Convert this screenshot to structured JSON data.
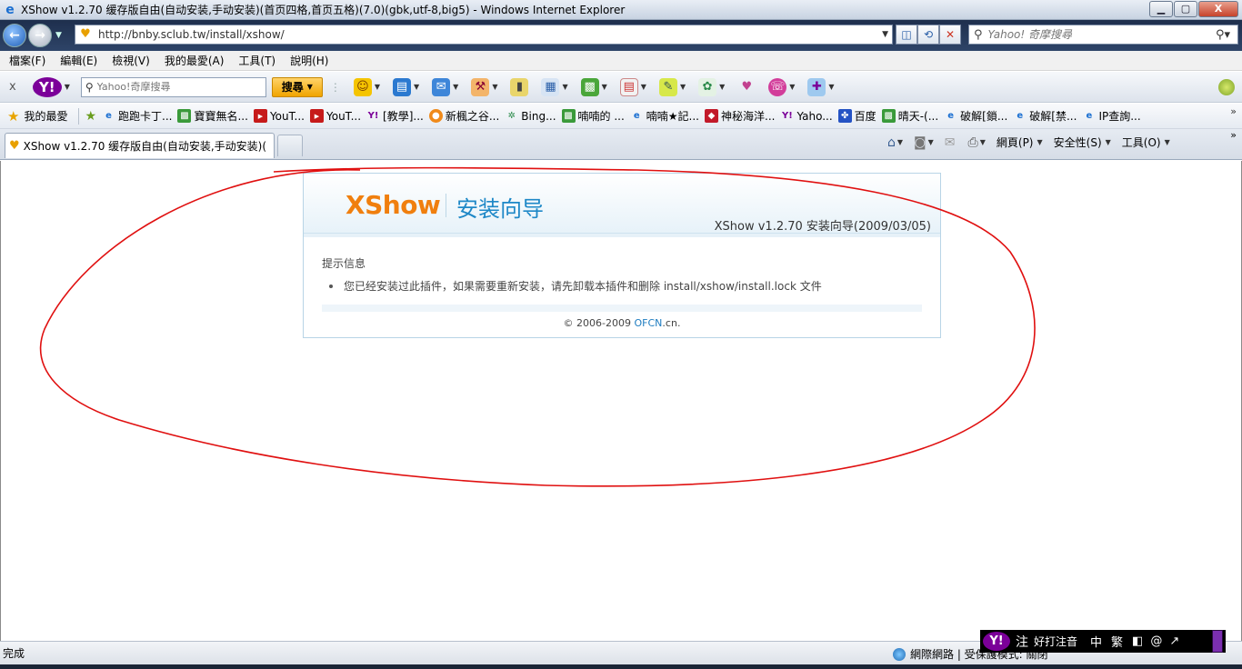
{
  "window": {
    "title": "XShow v1.2.70 缓存版自由(自动安装,手动安装)(首页四格,首页五格)(7.0)(gbk,utf-8,big5) - Windows Internet Explorer",
    "minimize": "▁",
    "maximize": "▢",
    "close": "X"
  },
  "address": {
    "url": "http://bnby.sclub.tw/install/xshow/",
    "search_placeholder": "Yahoo! 奇摩搜尋"
  },
  "menu": {
    "items": [
      "檔案(F)",
      "編輯(E)",
      "檢視(V)",
      "我的最愛(A)",
      "工具(T)",
      "說明(H)"
    ]
  },
  "yahoo_toolbar": {
    "close": "x",
    "logo": "Y!",
    "search_placeholder": "Yahoo!奇摩搜尋",
    "search_button": "搜尋"
  },
  "favorites": {
    "label": "我的最愛",
    "items": [
      "跑跑卡丁...",
      "寶寶無名...",
      "YouT...",
      "YouT...",
      "[教學]...",
      "新楓之谷...",
      "Bing...",
      "喃喃的 ...",
      "喃喃★記...",
      "神秘海洋...",
      "Yaho...",
      "百度",
      "晴天-(...",
      "破解[鎖...",
      "破解[禁...",
      "IP查詢..."
    ]
  },
  "tabs": {
    "active_label": "XShow v1.2.70 缓存版自由(自动安装,手动安装)(...",
    "cmd_page": "網頁(P)",
    "cmd_safety": "安全性(S)",
    "cmd_tools": "工具(O)"
  },
  "install": {
    "logo": "XShow",
    "subtitle": "安装向导",
    "version": "XShow v1.2.70 安装向导(2009/03/05)",
    "section_title": "提示信息",
    "message": "您已经安装过此插件，如果需要重新安装，请先卸载本插件和删除 install/xshow/install.lock 文件",
    "copyright_prefix": "© 2006-2009",
    "copyright_link": "OFCN",
    "copyright_suffix": ".cn."
  },
  "status": {
    "text": "完成",
    "zone": "網際網路 | 受保護模式: 關閉"
  },
  "ime": {
    "logo": "Y!",
    "zhu": "注",
    "mode": "好打注音",
    "zh": "中",
    "trad": "繁",
    "half": "◧",
    "at": "@",
    "tool": "↗"
  }
}
